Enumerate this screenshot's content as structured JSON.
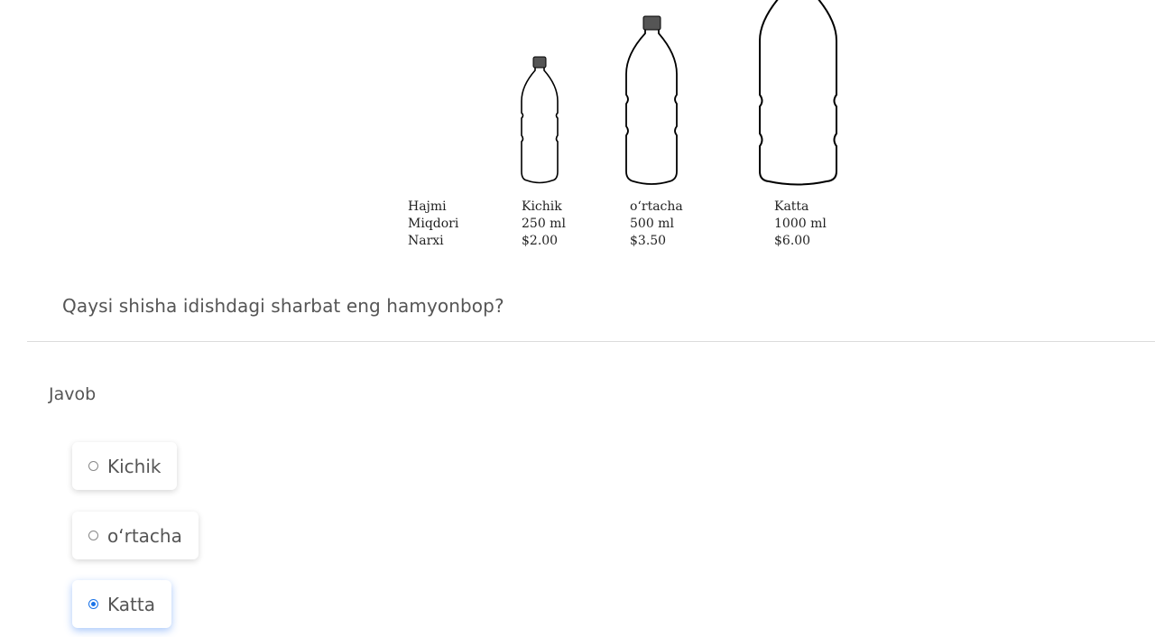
{
  "figure": {
    "rows_header": [
      "Hajmi",
      "Miqdori",
      "Narxi"
    ],
    "columns": [
      {
        "name": "Kichik",
        "volume": "250 ml",
        "price": "$2.00"
      },
      {
        "name": "o‘rtacha",
        "volume": "500 ml",
        "price": "$3.50"
      },
      {
        "name": "Katta",
        "volume": "1000 ml",
        "price": "$6.00"
      }
    ]
  },
  "question": {
    "text": "Qaysi shisha idishdagi sharbat eng hamyonbop?"
  },
  "answer": {
    "label": "Javob",
    "options": [
      {
        "label": "Kichik",
        "selected": false
      },
      {
        "label": "o‘rtacha",
        "selected": false
      },
      {
        "label": "Katta",
        "selected": true
      }
    ]
  },
  "colors": {
    "accent": "#1a73e8",
    "bottle_cap": "#555555"
  }
}
